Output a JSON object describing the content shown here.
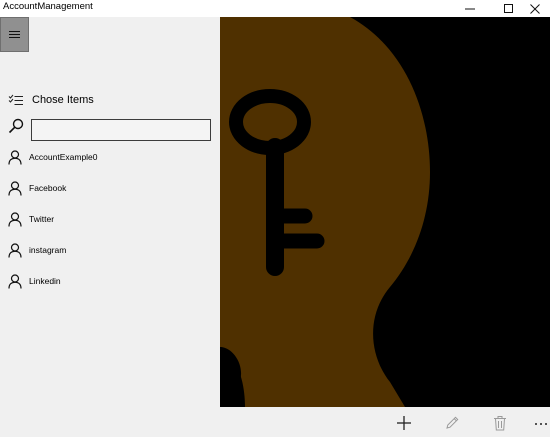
{
  "window": {
    "title": "AccountManagement",
    "controls": [
      "minimize",
      "maximize",
      "close"
    ]
  },
  "sidebar": {
    "menu_button_icon": "hamburger-icon",
    "chose_items_label": "Chose Items",
    "search": {
      "value": "",
      "placeholder": ""
    },
    "accounts": [
      {
        "label": "AccountExample0",
        "icon": "person-icon"
      },
      {
        "label": "Facebook",
        "icon": "person-icon"
      },
      {
        "label": "Twitter",
        "icon": "person-icon"
      },
      {
        "label": "instagram",
        "icon": "person-icon"
      },
      {
        "label": "Linkedin",
        "icon": "person-icon"
      }
    ]
  },
  "hero": {
    "image": "key-on-head-silhouette",
    "colors": {
      "background": "#000000",
      "shape": "#4f3000"
    }
  },
  "appbar": {
    "buttons": [
      {
        "name": "add",
        "icon": "plus-icon",
        "enabled": true
      },
      {
        "name": "edit",
        "icon": "pencil-icon",
        "enabled": false
      },
      {
        "name": "delete",
        "icon": "trash-icon",
        "enabled": false
      },
      {
        "name": "more",
        "icon": "ellipsis-icon",
        "enabled": true
      }
    ]
  }
}
